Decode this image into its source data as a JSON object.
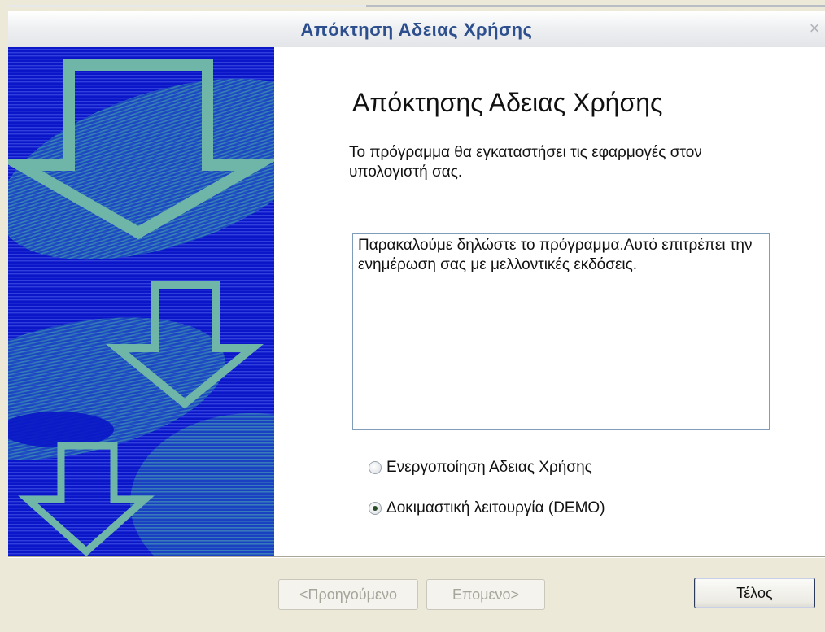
{
  "window": {
    "title": "Απόκτηση Αδειας Χρήσης",
    "close_glyph": "×"
  },
  "banner": {
    "icon": "download-arrows-banner",
    "colors": {
      "base": "#0a16c8",
      "accent": "#6fb5a8",
      "line": "#2a3ad8"
    }
  },
  "content": {
    "heading": "Απόκτησης Αδειας Χρήσης",
    "subtitle": "Το πρόγραμμα θα εγκαταστήσει τις εφαρμογές στον υπολογιστή σας.",
    "message": "Παρακαλούμε δηλώστε το πρόγραμμα.Αυτό επιτρέπει την ενημέρωση σας με μελλοντικές εκδόσεις.",
    "options": [
      {
        "label": "Ενεργοποίηση Αδειας Χρήσης",
        "checked": false
      },
      {
        "label": "Δοκιμαστική λειτουργία (DEMO)",
        "checked": true
      }
    ]
  },
  "buttons": {
    "back": "<Προηγούμενο",
    "next": "Επομενο>",
    "finish": "Τέλος"
  }
}
